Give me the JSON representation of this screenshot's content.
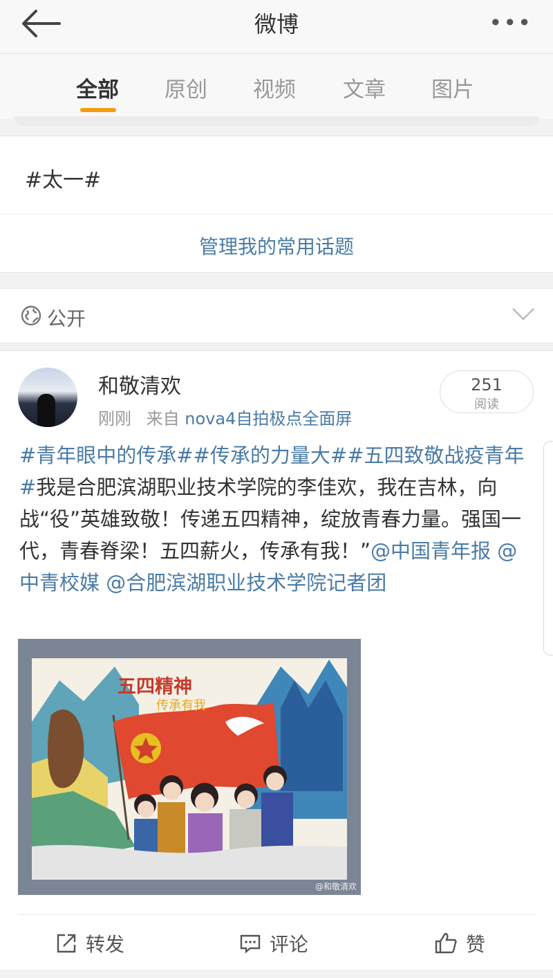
{
  "header": {
    "title": "微博",
    "more_label": "•••"
  },
  "tabs": [
    {
      "label": "全部",
      "active": true
    },
    {
      "label": "原创",
      "active": false
    },
    {
      "label": "视频",
      "active": false
    },
    {
      "label": "文章",
      "active": false
    },
    {
      "label": "图片",
      "active": false
    }
  ],
  "colors": {
    "accent": "#f39c12",
    "link": "#4a7ba6"
  },
  "topic_panel": {
    "topic": "#太一#",
    "manage_label": "管理我的常用话题"
  },
  "privacy": {
    "icon": "globe-icon",
    "label": "公开"
  },
  "post": {
    "author": "和敬清欢",
    "time": "刚刚",
    "source_prefix": "来自",
    "device": "nova4自拍极点全面屏",
    "reads_count": "251",
    "reads_label": "阅读",
    "text": {
      "hashtags": "#青年眼中的传承##传承的力量大##五四致敬战疫青年#",
      "body": "我是合肥滨湖职业技术学院的李佳欢，我在吉林，向战“役”英雄致敬！传递五四精神，绽放青春力量。强国一代，青春脊梁！五四薪火，传承有我！”",
      "mention_1": "@中国青年报",
      "mention_2": "@中青校媒",
      "mention_3": "@合肥滨湖职业技术学院记者团"
    },
    "image": {
      "title": "五四精神",
      "subtitle": "传承有我",
      "watermark": "@和敬清欢"
    }
  },
  "actions": {
    "repost": "转发",
    "comment": "评论",
    "like": "赞"
  }
}
